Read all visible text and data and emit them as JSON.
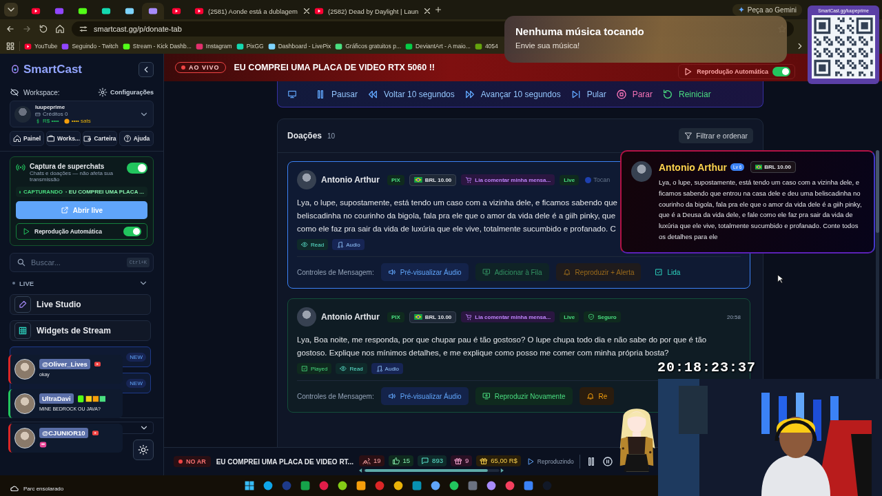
{
  "browser": {
    "tabs": [
      {
        "kind": "youtube",
        "selected": false
      },
      {
        "kind": "twitch",
        "selected": false
      },
      {
        "kind": "kick",
        "selected": false
      },
      {
        "kind": "pixgg",
        "selected": false
      },
      {
        "kind": "livepix",
        "selected": false
      },
      {
        "kind": "smartcast",
        "selected": true
      },
      {
        "kind": "youtube",
        "selected": false
      },
      {
        "kind": "youtube",
        "title": "(2581) Aonde está a dublagem",
        "selected": false
      },
      {
        "kind": "youtube",
        "title": "(2582) Dead by Daylight | Laun",
        "selected": false
      }
    ],
    "url": "smartcast.gg/p/donate-tab",
    "bookmarks": [
      {
        "kind": "youtube",
        "label": "YouTube"
      },
      {
        "kind": "twitch",
        "label": "Seguindo - Twitch"
      },
      {
        "kind": "kick",
        "label": "Stream - Kick Dashb..."
      },
      {
        "kind": "instagram",
        "label": "Instagram"
      },
      {
        "kind": "pixgg",
        "label": "PixGG"
      },
      {
        "kind": "livepix",
        "label": "Dashboard - LivePix"
      },
      {
        "kind": "shield",
        "label": "Gráficos gratuitos p..."
      },
      {
        "kind": "deviantart",
        "label": "DeviantArt - A maio..."
      },
      {
        "kind": "frog",
        "label": "4054"
      }
    ],
    "assistant": "Peça ao Gemini"
  },
  "toast": {
    "title": "Nenhuma música tocando",
    "subtitle": "Envie sua música!"
  },
  "qr_card": {
    "caption": "SmartCast.gg/luupeprime"
  },
  "sidebar": {
    "brand": "SmartCast",
    "workspace_label": "Workspace:",
    "settings": "Configurações",
    "account": {
      "name": "luupeprime",
      "credits": "Créditos 0",
      "balance": "R$ ••••",
      "sats": "•••• sats"
    },
    "nav": [
      {
        "kind": "home",
        "label": "Painel"
      },
      {
        "kind": "briefcase",
        "label": "Works..."
      },
      {
        "kind": "wallet",
        "label": "Carteira"
      },
      {
        "kind": "help",
        "label": "Ajuda"
      }
    ],
    "capture": {
      "title": "Captura de superchats",
      "subtitle": "Chats e doações — não afeta sua transmissão",
      "on": true,
      "status": "CAPTURANDO",
      "status_detail": "· EU COMPREI UMA PLACA ...",
      "open_button": "Abrir live",
      "autoplay": {
        "label": "Reprodução Automática",
        "on": true
      }
    },
    "search": {
      "placeholder": "Buscar...",
      "shortcut": "Ctrl+K"
    },
    "section": {
      "label": "LIVE",
      "expanded": true
    },
    "items": [
      {
        "kind": "studio",
        "label": "Live Studio"
      },
      {
        "kind": "widgets",
        "label": "Widgets de Stream"
      },
      {
        "kind": "covered",
        "badge": "NEW"
      },
      {
        "kind": "covered",
        "badge": "NEW"
      }
    ]
  },
  "banner": {
    "live_label": "AO VIVO",
    "title": "EU COMPREI UMA PLACA DE VIDEO RTX 5060 !!",
    "autoplay": {
      "label": "Reprodução Automática",
      "on": true
    }
  },
  "player_controls": [
    {
      "kind": "pause",
      "label": "Pausar"
    },
    {
      "kind": "back",
      "label": "Voltar 10 segundos"
    },
    {
      "kind": "forward",
      "label": "Avançar 10 segundos"
    },
    {
      "kind": "skip",
      "label": "Pular"
    },
    {
      "kind": "stop",
      "label": "Parar"
    },
    {
      "kind": "restart",
      "label": "Reiniciar"
    }
  ],
  "donations": {
    "title": "Doações",
    "count": "10",
    "filter_button": "Filtrar e ordenar",
    "items": [
      {
        "selected": true,
        "name": "Antonio Arthur",
        "method": "PIX",
        "amount": "BRL 10.00",
        "tts": "Lia comentar minha mensa...",
        "live": "Live",
        "status": {
          "kind": "playing",
          "label": "Tocan"
        },
        "message_lines": [
          "Lya, o lupe, supostamente, está tendo um caso com a vizinha dele, e ficamos sabendo que",
          "beliscadinha no courinho da bigola, fala pra ele que o amor da vida dele é a giih pinky, que",
          "como ele faz pra sair da vida de luxúria que ele vive, totalmente sucumbido e profanado. C"
        ],
        "tags": [
          {
            "kind": "read",
            "label": "Read"
          },
          {
            "kind": "audio",
            "label": "Audio"
          }
        ],
        "controls_label": "Controles de Mensagem:",
        "controls": [
          {
            "kind": "preview",
            "label": "Pré-visualizar Áudio",
            "disabled": false
          },
          {
            "kind": "queue",
            "label": "Adicionar à Fila",
            "disabled": true
          },
          {
            "kind": "alert",
            "label": "Reproduzir + Alerta",
            "disabled": true
          },
          {
            "kind": "read",
            "label": "Lida",
            "disabled": false
          }
        ]
      },
      {
        "selected": false,
        "name": "Antonio Arthur",
        "method": "PIX",
        "amount": "BRL 10.00",
        "tts": "Lia comentar minha mensa...",
        "live": "Live",
        "status": {
          "kind": "safe",
          "label": "Seguro"
        },
        "time": "20:58",
        "message_lines": [
          "Lya, Boa noite, me responda, por que chupar pau é tão gostoso? O lupe chupa todo dia e não sabe do por que é tão",
          "gostoso. Explique nos mínimos detalhes, e me explique como posso me comer com minha própria bosta?"
        ],
        "tags": [
          {
            "kind": "played",
            "label": "Played"
          },
          {
            "kind": "read",
            "label": "Read"
          },
          {
            "kind": "audio",
            "label": "Audio"
          }
        ],
        "controls_label": "Controles de Mensagem:",
        "controls": [
          {
            "kind": "preview",
            "label": "Pré-visualizar Áudio",
            "disabled": false
          },
          {
            "kind": "replay",
            "label": "Reproduzir Novamente",
            "disabled": false
          },
          {
            "kind": "alert",
            "label": "Re",
            "disabled": false
          }
        ]
      }
    ]
  },
  "popup": {
    "name": "Antonio Arthur",
    "level": "Lv 6",
    "amount": "BRL 10.00",
    "message": "Lya, o lupe, supostamente, está tendo um caso com a vizinha dele, e ficamos sabendo que entrou na casa dele e deu uma beliscadinha no courinho da bigola, fala pra ele que o amor da vida dele é a giih pinky, que é a Deusa da vida dele, e fale como ele faz pra sair da vida de luxúria que ele vive, totalmente sucumbido e profanado. Conte todos os detalhes para ele"
  },
  "chat_overlay": [
    {
      "user": "@Oliver_Lives",
      "kind": "youtube",
      "message": "okay",
      "color": "#dc2626"
    },
    {
      "user": "UltraDavi",
      "kind": "kick",
      "message": "MINE BEDROCK OU JAVA?",
      "color": "#22c55e"
    },
    {
      "user": "@CJUNIOR10",
      "kind": "youtube",
      "color": "#dc2626"
    }
  ],
  "clock": "20:18:23:37",
  "bottom_bar": {
    "status": "NO AR",
    "title": "EU COMPREI UMA PLACA DE VIDEO RT...",
    "stats": [
      {
        "kind": "viewers",
        "value": "19"
      },
      {
        "kind": "likes",
        "value": "15"
      },
      {
        "kind": "chats",
        "value": "893"
      },
      {
        "kind": "gifts",
        "value": "9"
      },
      {
        "kind": "money",
        "value": "65,00 R$"
      }
    ],
    "playback": "Reproduzindo"
  },
  "taskbar": {
    "weather": "Parc ensolarado"
  }
}
